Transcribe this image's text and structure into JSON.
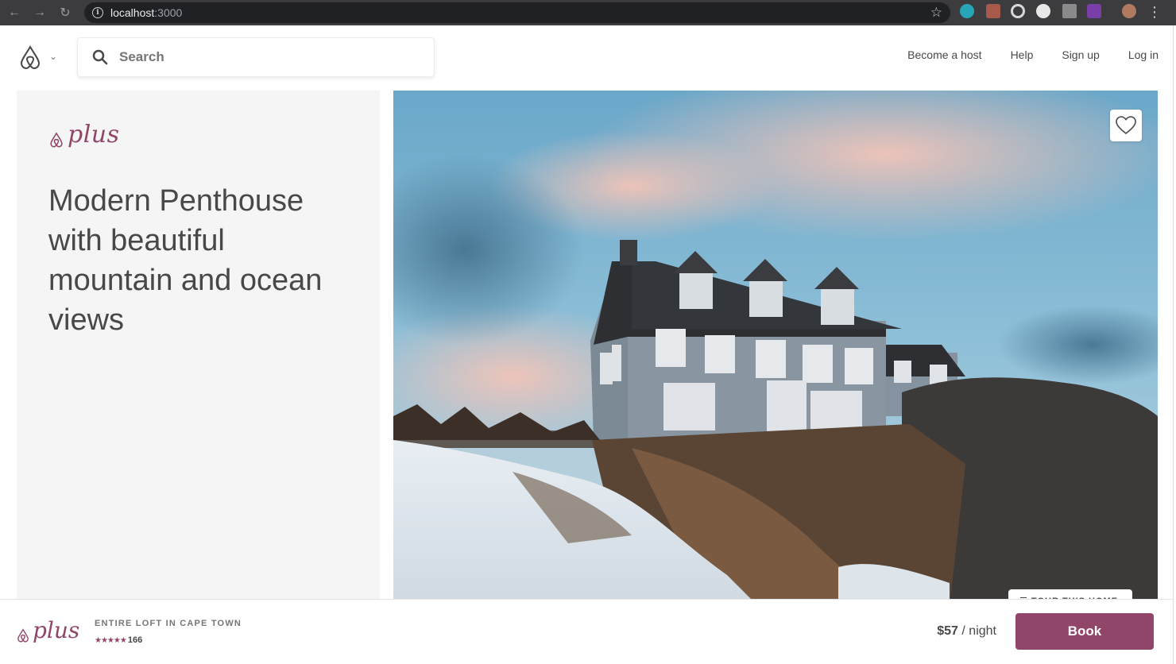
{
  "browser": {
    "url_host": "localhost",
    "url_port": ":3000"
  },
  "header": {
    "search_placeholder": "Search",
    "nav": {
      "become_host": "Become a host",
      "help": "Help",
      "sign_up": "Sign up",
      "log_in": "Log in"
    }
  },
  "listing": {
    "brand": "plus",
    "title": "Modern Penthouse with beautiful mountain and ocean views",
    "tour_label": "TOUR THIS HOME"
  },
  "footer": {
    "brand": "plus",
    "listing_type": "ENTIRE LOFT IN CAPE TOWN",
    "stars": "★★★★★",
    "review_count": "166",
    "price": "$57",
    "price_unit": "/ night",
    "book_label": "Book"
  },
  "colors": {
    "brand": "#914669",
    "text": "#484848",
    "panel_bg": "#f5f5f5"
  }
}
